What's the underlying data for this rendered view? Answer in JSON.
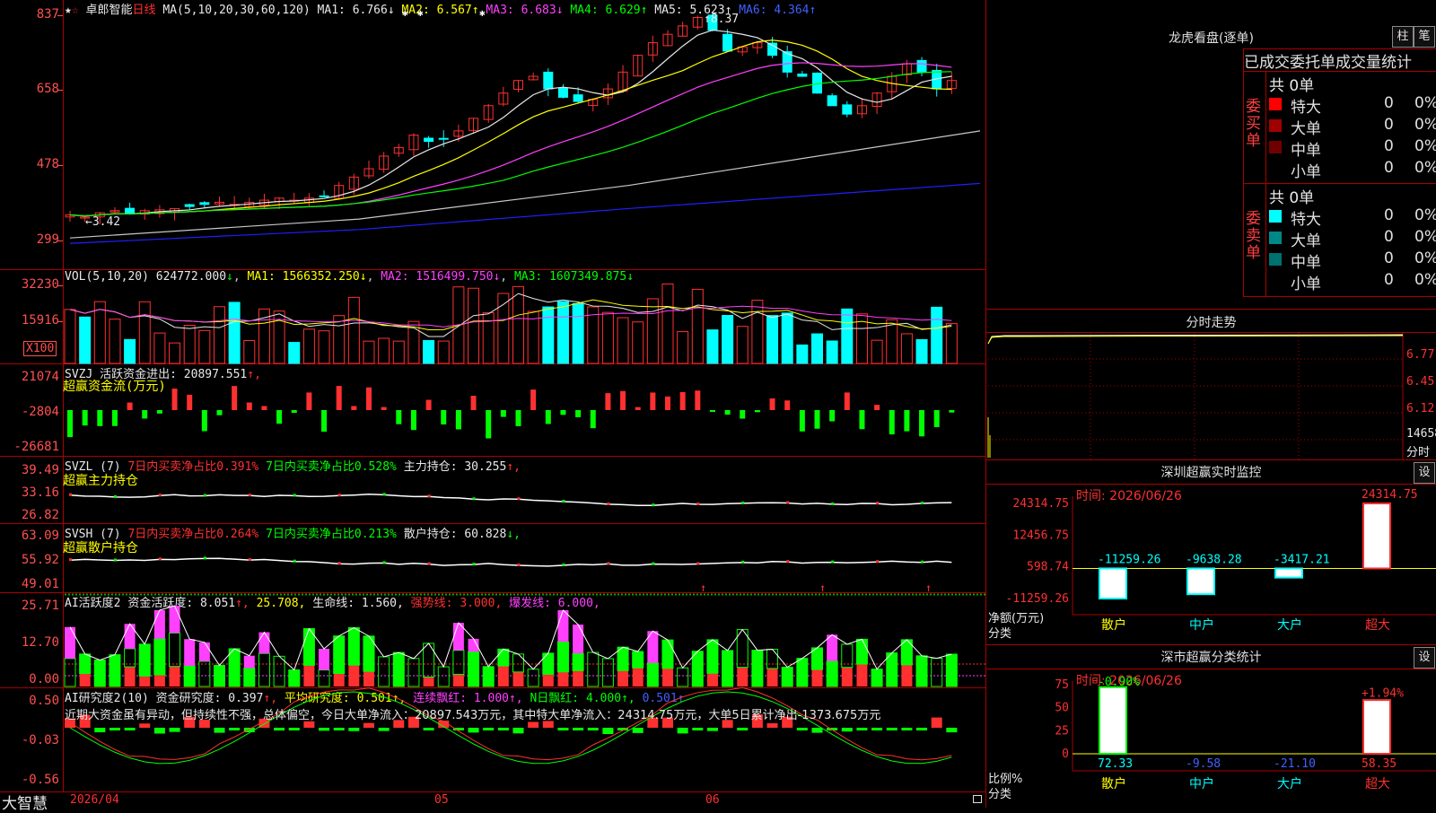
{
  "main": {
    "stock_name": "卓郎智能",
    "period": "日线",
    "ma_params": "MA(5,10,20,30,60,120)",
    "ma": [
      {
        "label": "MA1:",
        "value": "6.766",
        "arrow": "↓"
      },
      {
        "label": "MA2:",
        "value": "6.567",
        "arrow": "↑"
      },
      {
        "label": "MA3:",
        "value": "6.683",
        "arrow": "↓"
      },
      {
        "label": "MA4:",
        "value": "6.629",
        "arrow": "↑"
      },
      {
        "label": "MA5:",
        "value": "5.623",
        "arrow": "↑"
      },
      {
        "label": "MA6:",
        "value": "4.364",
        "arrow": "↑"
      }
    ],
    "y_labels": [
      "837",
      "658",
      "478",
      "299"
    ],
    "high_mark": "8.37",
    "low_mark": "←3.42"
  },
  "vol": {
    "header": "VOL(5,10,20)",
    "value": "624772.000",
    "ma": [
      {
        "label": "MA1:",
        "value": "1566352.250",
        "arrow": "↓"
      },
      {
        "label": "MA2:",
        "value": "1516499.750",
        "arrow": "↓"
      },
      {
        "label": "MA3:",
        "value": "1607349.875",
        "arrow": "↓"
      }
    ],
    "y_labels": [
      "32230",
      "15916"
    ],
    "unit": "X100"
  },
  "svzj": {
    "name": "SVZJ",
    "label": "活跃资金进出:",
    "value": "20897.551",
    "arrow": "↑,",
    "subtitle": "超赢资金流(万元)",
    "y_labels": [
      "21074",
      "-2804",
      "-26681"
    ]
  },
  "svzl": {
    "name": "SVZL (7)",
    "l1": "7日内买卖净占比0.391%",
    "l2": "7日内买卖净占比0.528%",
    "l3": "主力持仓:",
    "value": "30.255",
    "arrow": "↑,",
    "subtitle": "超赢主力持仓",
    "y_labels": [
      "39.49",
      "33.16",
      "26.82"
    ]
  },
  "svsh": {
    "name": "SVSH (7)",
    "l1": "7日内买卖净占比0.264%",
    "l2": "7日内买卖净占比0.213%",
    "l3": "散户持仓:",
    "value": "60.828",
    "arrow": "↓,",
    "subtitle": "超赢散户持仓",
    "y_labels": [
      "63.09",
      "55.92",
      "49.01"
    ]
  },
  "ai_active": {
    "name": "AI活跃度2",
    "items": [
      {
        "label": "资金活跃度:",
        "value": "8.051",
        "arrow": "↑,"
      },
      {
        "label": "",
        "value": "25.708,",
        "arrow": ""
      },
      {
        "label": "生命线:",
        "value": "1.560,",
        "arrow": ""
      },
      {
        "label": "强势线:",
        "value": "3.000,",
        "arrow": ""
      },
      {
        "label": "爆发线:",
        "value": "6.000,",
        "arrow": ""
      }
    ],
    "y_labels": [
      "25.71",
      "12.70",
      "0.00"
    ]
  },
  "ai_research": {
    "name": "AI研究度2(10)",
    "items": [
      {
        "label": "资金研究度:",
        "value": "0.397",
        "arrow": "↑,"
      },
      {
        "label": "平均研究度:",
        "value": "0.501",
        "arrow": "↑,"
      },
      {
        "label": "连续飘红:",
        "value": "1.000",
        "arrow": "↑,"
      },
      {
        "label": "N日飘红:",
        "value": "4.000",
        "arrow": "↑,"
      },
      {
        "label": "",
        "value": "0.501",
        "arrow": "↑"
      }
    ],
    "comment": "近期大资金虽有异动，但持续性不强，总体偏空，今日大单净流入：20897.543万元，其中特大单净流入：24314.75万元，大单5日累计净出-1373.675万元",
    "y_labels": [
      "0.50",
      "-0.03",
      "-0.56"
    ]
  },
  "bottom": {
    "brand": "大智慧",
    "dates": [
      "2026/04",
      "05",
      "06"
    ]
  },
  "dragon": {
    "title": "龙虎看盘(逐单)",
    "btn_bar": "柱",
    "btn_tick": "笔",
    "tabs": [
      "已成交",
      "委托单",
      "成交量统计"
    ],
    "buy": {
      "side": "委买单",
      "total": "共 0单",
      "rows": [
        {
          "name": "特大",
          "count": "0",
          "pct": "0%",
          "color": "#ff0000"
        },
        {
          "name": "大单",
          "count": "0",
          "pct": "0%",
          "color": "#a00000"
        },
        {
          "name": "中单",
          "count": "0",
          "pct": "0%",
          "color": "#700000"
        },
        {
          "name": "小单",
          "count": "0",
          "pct": "0%",
          "color": ""
        }
      ]
    },
    "sell": {
      "side": "委卖单",
      "total": "共 0单",
      "rows": [
        {
          "name": "特大",
          "count": "0",
          "pct": "0%",
          "color": "#00ffff"
        },
        {
          "name": "大单",
          "count": "0",
          "pct": "0%",
          "color": "#008888"
        },
        {
          "name": "中单",
          "count": "0",
          "pct": "0%",
          "color": "#007070"
        },
        {
          "name": "小单",
          "count": "0",
          "pct": "0%",
          "color": ""
        }
      ]
    }
  },
  "intraday": {
    "title": "分时走势",
    "y_labels": [
      "6.77",
      "6.45",
      "6.12"
    ],
    "vol_label": "14658",
    "time_label": "分时"
  },
  "sz_monitor": {
    "title": "深圳超赢实时监控",
    "btn": "设",
    "date": "时间: 2026/06/26",
    "y_labels": [
      "24314.75",
      "12456.75",
      "598.74",
      "-11259.26"
    ],
    "y_title": "净额(万元)",
    "x_title": "分类",
    "categories": [
      "散户",
      "中户",
      "大户",
      "超大"
    ],
    "values_text": [
      "-11259.26",
      "-9638.28",
      "-3417.21",
      "24314.75"
    ]
  },
  "sz_class": {
    "title": "深市超赢分类统计",
    "btn": "设",
    "date": "时间: 2026/06/26",
    "y_labels": [
      "75",
      "50",
      "25",
      "0"
    ],
    "y_title": "比例%",
    "x_title": "分类",
    "categories": [
      "散户",
      "中户",
      "大户",
      "超大"
    ],
    "top_texts": [
      "-0.90%",
      "+1.94%"
    ],
    "bottom_values": [
      "72.33",
      "-9.58",
      "-21.10",
      "58.35"
    ]
  },
  "chart_data": [
    {
      "type": "bar",
      "title": "深圳超赢实时监控",
      "ylabel": "净额(万元)",
      "xlabel": "分类",
      "categories": [
        "散户",
        "中户",
        "大户",
        "超大"
      ],
      "values": [
        -11259.26,
        -9638.28,
        -3417.21,
        24314.75
      ],
      "ylim": [
        -11259.26,
        24314.75
      ]
    },
    {
      "type": "bar",
      "title": "深市超赢分类统计",
      "ylabel": "比例%",
      "xlabel": "分类",
      "categories": [
        "散户",
        "中户",
        "大户",
        "超大"
      ],
      "values": [
        72.33,
        -9.58,
        -21.1,
        58.35
      ],
      "ylim": [
        0,
        75
      ]
    }
  ],
  "colors": {
    "up": "#ff3030",
    "down": "#00ffff",
    "grid": "#aa0000",
    "ma1": "#e8e8e8",
    "ma2": "#ffff00",
    "ma3": "#ff40ff",
    "ma4": "#00ff00",
    "ma5": "#c8c8c8",
    "ma6": "#2020ff"
  }
}
